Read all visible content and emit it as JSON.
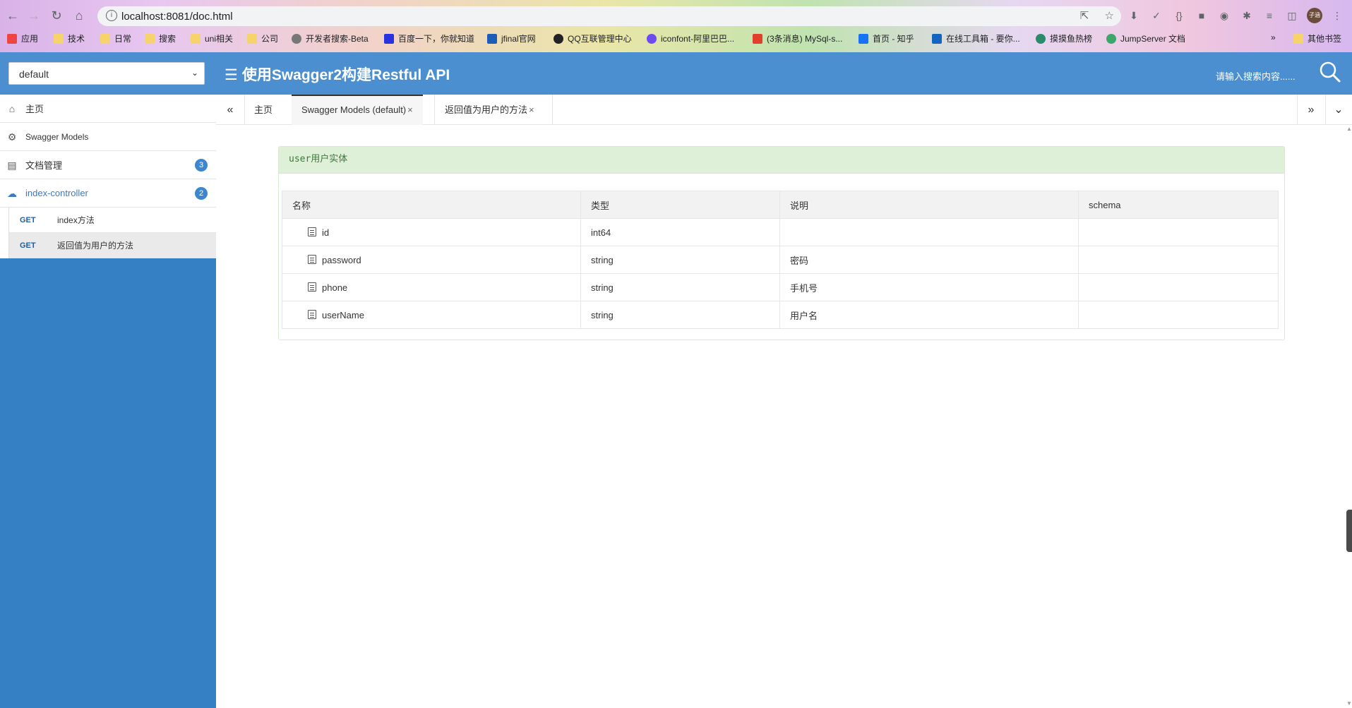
{
  "browser": {
    "url": "localhost:8081/doc.html",
    "bookmarks": [
      {
        "label": "应用"
      },
      {
        "label": "技术"
      },
      {
        "label": "日常"
      },
      {
        "label": "搜索"
      },
      {
        "label": "uni相关"
      },
      {
        "label": "公司"
      },
      {
        "label": "开发者搜索-Beta"
      },
      {
        "label": "百度一下，你就知道"
      },
      {
        "label": "jfinal官网"
      },
      {
        "label": "QQ互联管理中心"
      },
      {
        "label": "iconfont-阿里巴巴..."
      },
      {
        "label": "(3条消息) MySql-s..."
      },
      {
        "label": "首页 - 知乎"
      },
      {
        "label": "在线工具箱 - 要你..."
      },
      {
        "label": "摸摸鱼热榜"
      },
      {
        "label": "JumpServer 文档"
      }
    ],
    "more_bookmarks": "»",
    "other_bookmarks": "其他书签",
    "avatar_text": "子涵"
  },
  "header": {
    "group_select": "default",
    "title": "使用Swagger2构建Restful API",
    "search_placeholder": "请输入搜索内容......"
  },
  "sidebar": {
    "items": [
      {
        "label": "主页",
        "icon": "home-icon"
      },
      {
        "label": "Swagger Models",
        "icon": "models-icon"
      },
      {
        "label": "文档管理",
        "icon": "doc-manage-icon",
        "badge": "3"
      },
      {
        "label": "index-controller",
        "icon": "cloud-icon",
        "badge": "2"
      }
    ],
    "apis": [
      {
        "method": "GET",
        "name": "index方法"
      },
      {
        "method": "GET",
        "name": "返回值为用户的方法"
      }
    ]
  },
  "tabs": [
    {
      "label": "主页",
      "closable": false
    },
    {
      "label": "Swagger Models (default)",
      "closable": true,
      "active": true
    },
    {
      "label": "返回值为用户的方法",
      "closable": true
    }
  ],
  "tab_close_glyph": "×",
  "model": {
    "title": "user用户实体",
    "columns": [
      "名称",
      "类型",
      "说明",
      "schema"
    ],
    "rows": [
      {
        "name": "id",
        "type": "int64",
        "desc": "",
        "schema": ""
      },
      {
        "name": "password",
        "type": "string",
        "desc": "密码",
        "schema": ""
      },
      {
        "name": "phone",
        "type": "string",
        "desc": "手机号",
        "schema": ""
      },
      {
        "name": "userName",
        "type": "string",
        "desc": "用户名",
        "schema": ""
      }
    ]
  },
  "colors": {
    "header_blue": "#4c8fd0",
    "sidebar_blue": "#3580c5",
    "panel_green": "#dff0d8",
    "method_blue": "#1f5fa6"
  }
}
